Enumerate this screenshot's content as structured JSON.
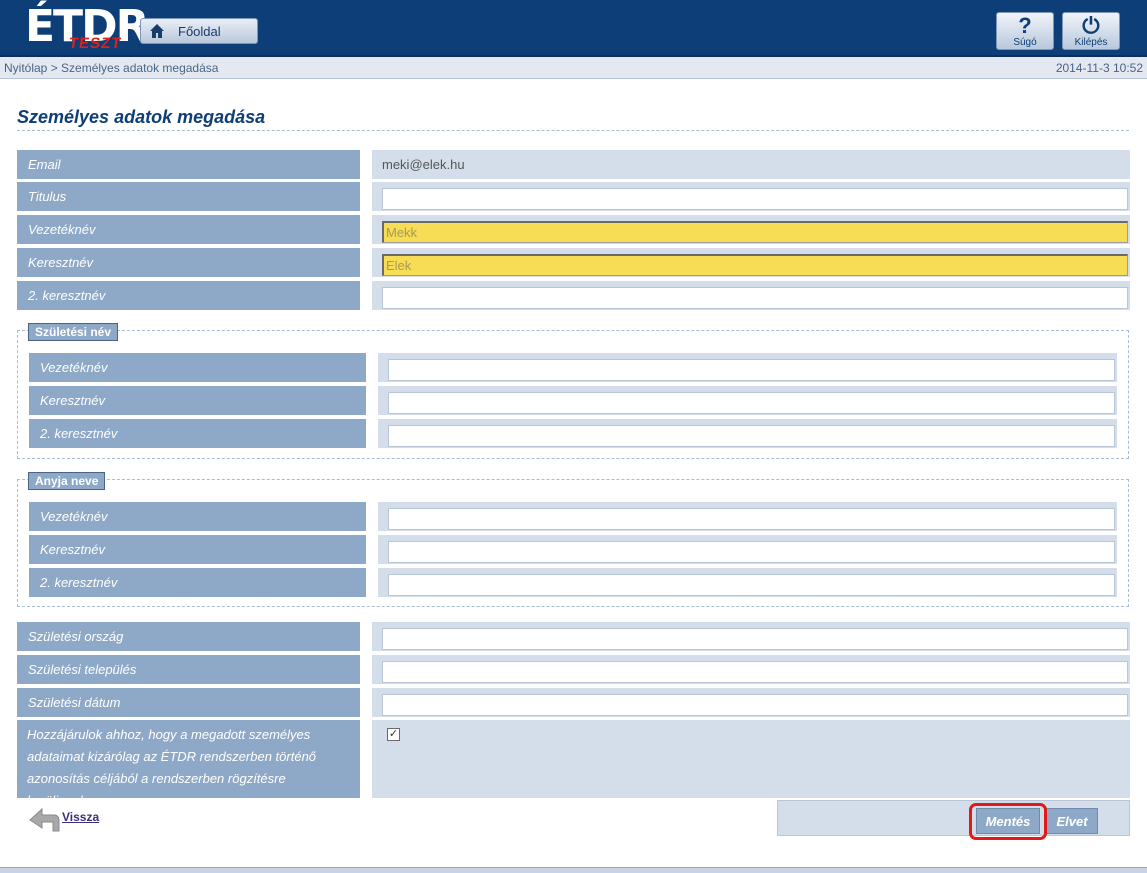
{
  "header": {
    "logo_text": "ÉTDR",
    "logo_badge": "TESZT",
    "home_label": "Főoldal",
    "help_label": "Súgó",
    "help_glyph": "?",
    "logout_label": "Kilépés",
    "logout_glyph": "⏻"
  },
  "breadcrumb": {
    "path": "Nyitólap > Személyes adatok megadása",
    "timestamp": "2014-11-3 10:52"
  },
  "page_title": "Személyes adatok megadása",
  "main_fields": {
    "email": {
      "label": "Email",
      "value": "meki@elek.hu"
    },
    "titulus": {
      "label": "Titulus",
      "value": ""
    },
    "vezeteknev": {
      "label": "Vezetéknév",
      "value": "Mekk"
    },
    "keresztnev": {
      "label": "Keresztnév",
      "value": "Elek"
    },
    "keresztnev2": {
      "label": "2. keresztnév",
      "value": ""
    }
  },
  "birth_name": {
    "legend": "Születési név",
    "vezeteknev": {
      "label": "Vezetéknév",
      "value": ""
    },
    "keresztnev": {
      "label": "Keresztnév",
      "value": ""
    },
    "keresztnev2": {
      "label": "2. keresztnév",
      "value": ""
    }
  },
  "mother_name": {
    "legend": "Anyja neve",
    "vezeteknev": {
      "label": "Vezetéknév",
      "value": ""
    },
    "keresztnev": {
      "label": "Keresztnév",
      "value": ""
    },
    "keresztnev2": {
      "label": "2. keresztnév",
      "value": ""
    }
  },
  "birth_info": {
    "orszag": {
      "label": "Születési ország",
      "value": ""
    },
    "telepules": {
      "label": "Születési település",
      "value": ""
    },
    "datum": {
      "label": "Születési dátum",
      "value": ""
    }
  },
  "consent": {
    "text": "Hozzájárulok ahhoz, hogy a megadott személyes adataimat kizárólag az ÉTDR rendszerben történő azonosítás céljából a rendszerben rögzítésre kerüljenek.",
    "checkmark": "✓"
  },
  "actions": {
    "back_label": "Vissza",
    "save_label": "Mentés",
    "cancel_label": "Elvet"
  },
  "colors": {
    "header_bg": "#0d3e78",
    "label_bg": "#8ea9c8",
    "value_bg": "#d3deea",
    "required_field": "#f7dc56",
    "highlight": "#e01919"
  }
}
